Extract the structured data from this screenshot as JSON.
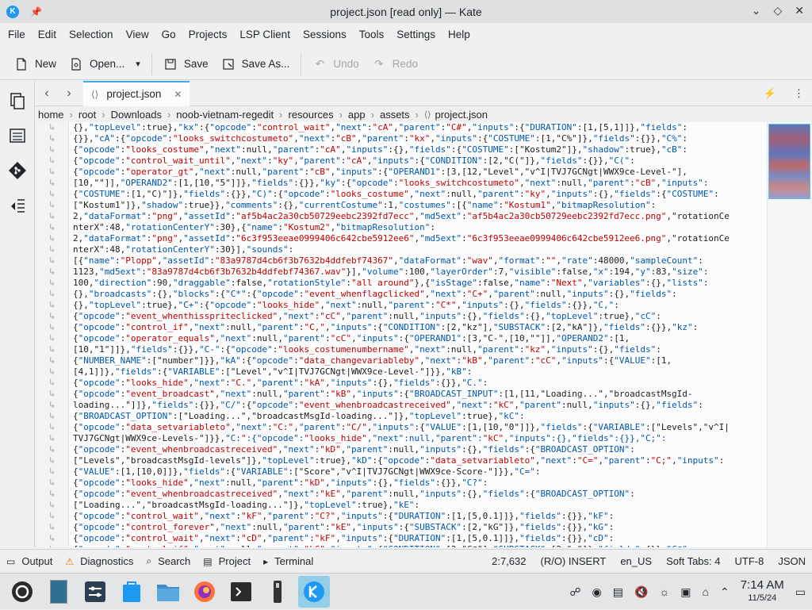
{
  "window": {
    "title": "project.json [read only] — Kate",
    "controls": [
      "chevron-down-icon",
      "diamond-icon",
      "close-icon"
    ]
  },
  "menu": [
    "File",
    "Edit",
    "Selection",
    "View",
    "Go",
    "Projects",
    "LSP Client",
    "Sessions",
    "Tools",
    "Settings",
    "Help"
  ],
  "toolbar": {
    "new": "New",
    "open": "Open...",
    "save": "Save",
    "save_as": "Save As...",
    "undo": "Undo",
    "redo": "Redo"
  },
  "tab": {
    "label": "project.json",
    "icon": "⟨⟩"
  },
  "breadcrumb": [
    "home",
    "root",
    "Downloads",
    "noob-vietnam-regedit",
    "resources",
    "app",
    "assets",
    "project.json"
  ],
  "breadcrumb_file_icon": "⟨⟩",
  "code_lines": [
    "{},\"topLevel\":true},\"kx\":{\"opcode\":\"control_wait\",\"next\":\"cA\",\"parent\":\"C#\",\"inputs\":{\"DURATION\":[1,[5,1]]},\"fields\":",
    "{}},\"cA\":{\"opcode\":\"looks_switchcostumeto\",\"next\":\"cB\",\"parent\":\"kx\",\"inputs\":{\"COSTUME\":[1,\"C%\"]},\"fields\":{}},\"C%\":",
    "{\"opcode\":\"looks_costume\",\"next\":null,\"parent\":\"cA\",\"inputs\":{},\"fields\":{\"COSTUME\":[\"Kostum2\"]},\"shadow\":true},\"cB\":",
    "{\"opcode\":\"control_wait_until\",\"next\":\"ky\",\"parent\":\"cA\",\"inputs\":{\"CONDITION\":[2,\"C(\"]},\"fields\":{}},\"C(\":",
    "{\"opcode\":\"operator_gt\",\"next\":null,\"parent\":\"cB\",\"inputs\":{\"OPERAND1\":[3,[12,\"Level\",\"v^I|TVJ7GCNgt|WWX9ce-Level-\"],",
    "[10,\"\"]],\"OPERAND2\":[1,[10,\"5\"]]},\"fields\":{}},\"ky\":{\"opcode\":\"looks_switchcostumeto\",\"next\":null,\"parent\":\"cB\",\"inputs\":",
    "{\"COSTUME\":[1,\"C)\"]},\"fields\":{}},\"C)\":{\"opcode\":\"looks_costume\",\"next\":null,\"parent\":\"ky\",\"inputs\":{},\"fields\":{\"COSTUME\":",
    "[\"Kostum1\"]},\"shadow\":true}},\"comments\":{},\"currentCostume\":1,\"costumes\":[{\"name\":\"Kostum1\",\"bitmapResolution\":",
    "2,\"dataFormat\":\"png\",\"assetId\":\"af5b4ac2a30cb50729eebc2392fd7ecc\",\"md5ext\":\"af5b4ac2a30cb50729eebc2392fd7ecc.png\",\"rotationCe",
    "nterX\":48,\"rotationCenterY\":30},{\"name\":\"Kostum2\",\"bitmapResolution\":",
    "2,\"dataFormat\":\"png\",\"assetId\":\"6c3f953eeae0999406c642cbe5912ee6\",\"md5ext\":\"6c3f953eeae0999406c642cbe5912ee6.png\",\"rotationCe",
    "nterX\":48,\"rotationCenterY\":30}],\"sounds\":",
    "[{\"name\":\"Plopp\",\"assetId\":\"83a9787d4cb6f3b7632b4ddfebf74367\",\"dataFormat\":\"wav\",\"format\":\"\",\"rate\":48000,\"sampleCount\":",
    "1123,\"md5ext\":\"83a9787d4cb6f3b7632b4ddfebf74367.wav\"}],\"volume\":100,\"layerOrder\":7,\"visible\":false,\"x\":194,\"y\":83,\"size\":",
    "100,\"direction\":90,\"draggable\":false,\"rotationStyle\":\"all around\"},{\"isStage\":false,\"name\":\"Next\",\"variables\":{},\"lists\":",
    "{},\"broadcasts\":{},\"blocks\":{\"C*\":{\"opcode\":\"event_whenflagclicked\",\"next\":\"C+\",\"parent\":null,\"inputs\":{},\"fields\":",
    "{},\"topLevel\":true},\"C+\":{\"opcode\":\"looks_hide\",\"next\":null,\"parent\":\"C*\",\"inputs\":{},\"fields\":{}},\"C,\":",
    "{\"opcode\":\"event_whenthisspriteclicked\",\"next\":\"cC\",\"parent\":null,\"inputs\":{},\"fields\":{},\"topLevel\":true},\"cC\":",
    "{\"opcode\":\"control_if\",\"next\":null,\"parent\":\"C,\",\"inputs\":{\"CONDITION\":[2,\"kz\"],\"SUBSTACK\":[2,\"kA\"]},\"fields\":{}},\"kz\":",
    "{\"opcode\":\"operator_equals\",\"next\":null,\"parent\":\"cC\",\"inputs\":{\"OPERAND1\":[3,\"C-\",[10,\"\"]],\"OPERAND2\":[1,",
    "[10,\"1\"]]},\"fields\":{}},\"C-\":{\"opcode\":\"looks_costumenumbername\",\"next\":null,\"parent\":\"kz\",\"inputs\":{},\"fields\":",
    "{\"NUMBER_NAME\":[\"number\"]}},\"kA\":{\"opcode\":\"data_changevariableby\",\"next\":\"kB\",\"parent\":\"cC\",\"inputs\":{\"VALUE\":[1,",
    "[4,1]]},\"fields\":{\"VARIABLE\":[\"Level\",\"v^I|TVJ7GCNgt|WWX9ce-Level-\"]}},\"kB\":",
    "{\"opcode\":\"looks_hide\",\"next\":\"C.\",\"parent\":\"kA\",\"inputs\":{},\"fields\":{}},\"C.\":",
    "{\"opcode\":\"event_broadcast\",\"next\":null,\"parent\":\"kB\",\"inputs\":{\"BROADCAST_INPUT\":[1,[11,\"Loading...\",\"broadcastMsgId-",
    "loading...\"]]},\"fields\":{}},\"C/\":{\"opcode\":\"event_whenbroadcastreceived\",\"next\":\"kC\",\"parent\":null,\"inputs\":{},\"fields\":",
    "{\"BROADCAST_OPTION\":[\"Loading...\",\"broadcastMsgId-loading...\"]},\"topLevel\":true},\"kC\":",
    "{\"opcode\":\"data_setvariableto\",\"next\":\"C:\",\"parent\":\"C/\",\"inputs\":{\"VALUE\":[1,[10,\"0\"]]},\"fields\":{\"VARIABLE\":[\"Levels\",\"v^I|",
    "TVJ7GCNgt|WWX9ce-Levels-\"]}},\"C:\":{\"opcode\":\"looks_hide\",\"next\":null,\"parent\":\"kC\",\"inputs\":{},\"fields\":{}},\"C;\":",
    "{\"opcode\":\"event_whenbroadcastreceived\",\"next\":\"kD\",\"parent\":null,\"inputs\":{},\"fields\":{\"BROADCAST_OPTION\":",
    "[\"Levels\",\"broadcastMsgId-levels\"]},\"topLevel\":true},\"kD\":{\"opcode\":\"data_setvariableto\",\"next\":\"C=\",\"parent\":\"C;\",\"inputs\":",
    "{\"VALUE\":[1,[10,0]]},\"fields\":{\"VARIABLE\":[\"Score\",\"v^I|TVJ7GCNgt|WWX9ce-Score-\"]}},\"C=\":",
    "{\"opcode\":\"looks_hide\",\"next\":null,\"parent\":\"kD\",\"inputs\":{},\"fields\":{}},\"C?\":",
    "{\"opcode\":\"event_whenbroadcastreceived\",\"next\":\"kE\",\"parent\":null,\"inputs\":{},\"fields\":{\"BROADCAST_OPTION\":",
    "[\"Loading...\",\"broadcastMsgId-loading...\"]},\"topLevel\":true},\"kE\":",
    "{\"opcode\":\"control_wait\",\"next\":\"kF\",\"parent\":\"C?\",\"inputs\":{\"DURATION\":[1,[5,0.1]]},\"fields\":{}},\"kF\":",
    "{\"opcode\":\"control_forever\",\"next\":null,\"parent\":\"kE\",\"inputs\":{\"SUBSTACK\":[2,\"kG\"]},\"fields\":{}},\"kG\":",
    "{\"opcode\":\"control_wait\",\"next\":\"cD\",\"parent\":\"kF\",\"inputs\":{\"DURATION\":[1,[5,0.1]]},\"fields\":{}},\"cD\":",
    "{\"opcode\":\"control_if\",\"next\":null,\"parent\":\"kG\",\"inputs\":{\"CONDITION\":[2,\"C@\"],\"SUBSTACK\":[2,\"c\"]},\"fields\":{}},\"C@\":"
  ],
  "statusbar": {
    "output": "Output",
    "diagnostics": "Diagnostics",
    "search": "Search",
    "project": "Project",
    "terminal": "Terminal",
    "cursor": "2:7,632",
    "mode": "(R/O) INSERT",
    "lang": "en_US",
    "tabs": "Soft Tabs: 4",
    "encoding": "UTF-8",
    "syntax": "JSON"
  },
  "clock": {
    "time": "7:14 AM",
    "date": "11/5/24"
  },
  "colors": {
    "accent": "#3daee9",
    "string": "#bf0303",
    "key": "#0057ae"
  }
}
